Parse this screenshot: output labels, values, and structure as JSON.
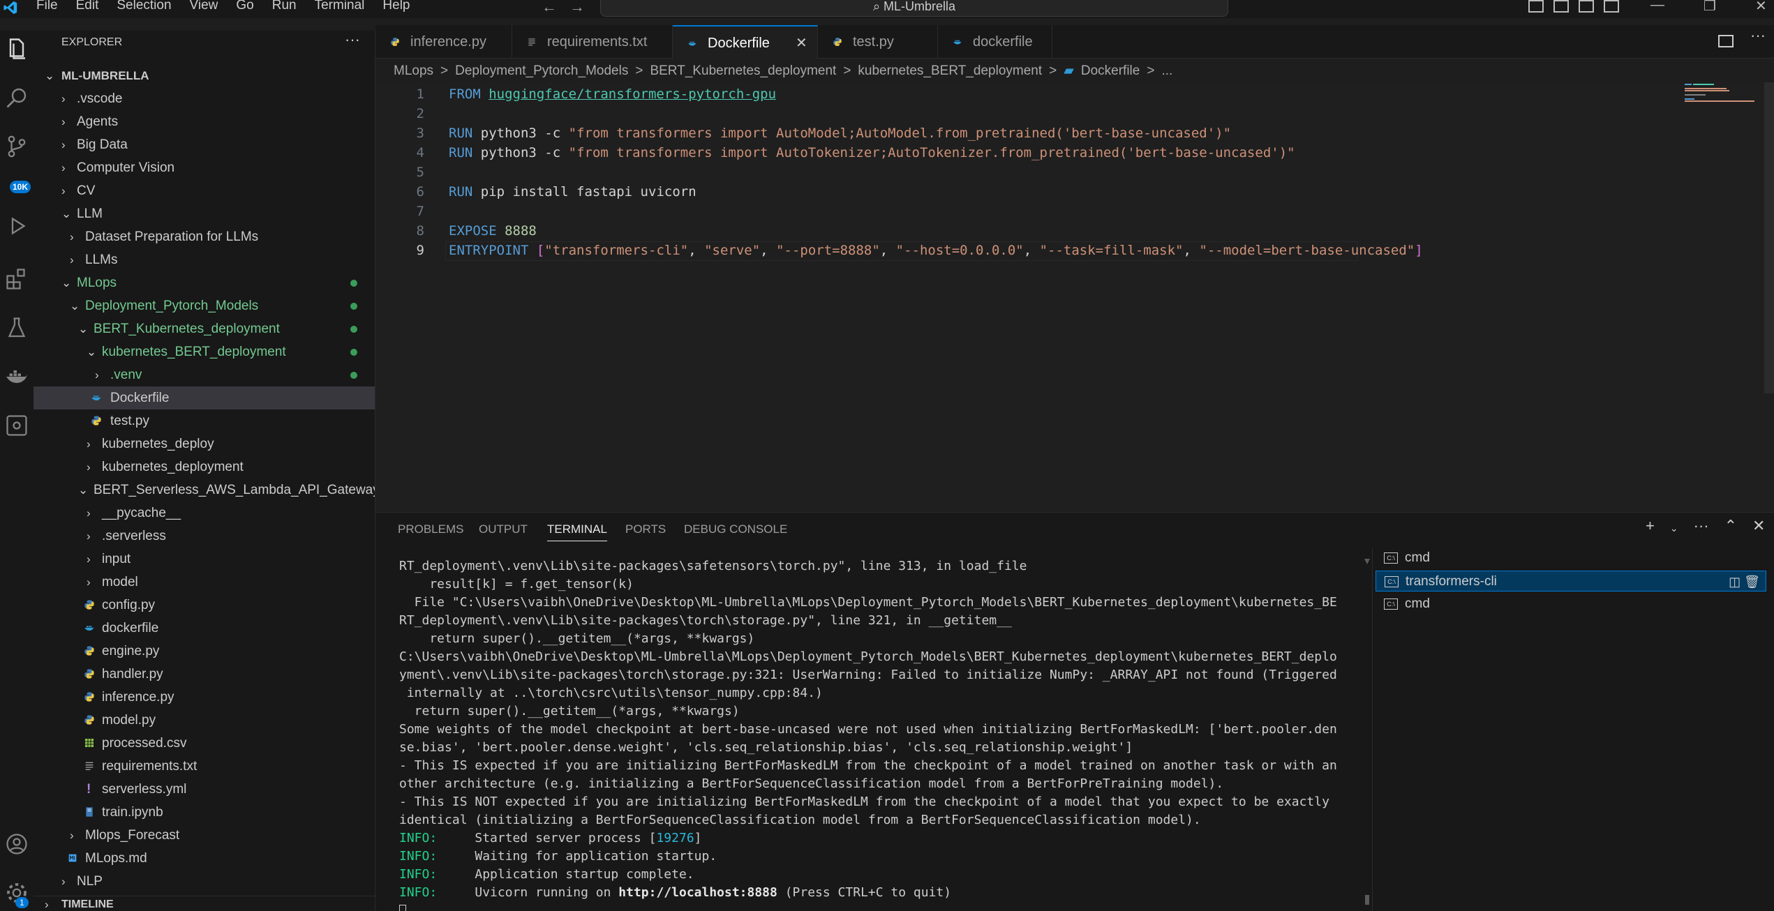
{
  "menu": [
    "File",
    "Edit",
    "Selection",
    "View",
    "Go",
    "Run",
    "Terminal",
    "Help"
  ],
  "search": {
    "text": "ML-Umbrella"
  },
  "activity": {
    "scm_badge": "10K",
    "accounts_badge": "1"
  },
  "explorer": {
    "title": "EXPLORER",
    "root": "ML-UMBRELLA",
    "items": [
      {
        "label": ".vscode",
        "type": "folder",
        "open": false
      },
      {
        "label": "Agents",
        "type": "folder",
        "open": false
      },
      {
        "label": "Big Data",
        "type": "folder",
        "open": false
      },
      {
        "label": "Computer Vision",
        "type": "folder",
        "open": false
      },
      {
        "label": "CV",
        "type": "folder",
        "open": false
      },
      {
        "label": "LLM",
        "type": "folder",
        "open": true
      },
      {
        "label": "Dataset Preparation for LLMs",
        "type": "folder",
        "open": false
      },
      {
        "label": "LLMs",
        "type": "folder",
        "open": false
      },
      {
        "label": "MLops",
        "type": "folder",
        "open": true
      },
      {
        "label": "Deployment_Pytorch_Models",
        "type": "folder",
        "open": true
      },
      {
        "label": "BERT_Kubernetes_deployment",
        "type": "folder",
        "open": true
      },
      {
        "label": "kubernetes_BERT_deployment",
        "type": "folder",
        "open": true
      },
      {
        "label": ".venv",
        "type": "folder",
        "open": false
      },
      {
        "label": "Dockerfile",
        "type": "docker"
      },
      {
        "label": "test.py",
        "type": "python"
      },
      {
        "label": "kubernetes_deploy",
        "type": "folder",
        "open": false
      },
      {
        "label": "kubernetes_deployment",
        "type": "folder",
        "open": false
      },
      {
        "label": "BERT_Serverless_AWS_Lambda_API_Gateway",
        "type": "folder",
        "open": true
      },
      {
        "label": "__pycache__",
        "type": "folder",
        "open": false
      },
      {
        "label": ".serverless",
        "type": "folder",
        "open": false
      },
      {
        "label": "input",
        "type": "folder",
        "open": false
      },
      {
        "label": "model",
        "type": "folder",
        "open": false
      },
      {
        "label": "config.py",
        "type": "python"
      },
      {
        "label": "dockerfile",
        "type": "docker"
      },
      {
        "label": "engine.py",
        "type": "python"
      },
      {
        "label": "handler.py",
        "type": "python"
      },
      {
        "label": "inference.py",
        "type": "python"
      },
      {
        "label": "model.py",
        "type": "python"
      },
      {
        "label": "processed.csv",
        "type": "csv"
      },
      {
        "label": "requirements.txt",
        "type": "text"
      },
      {
        "label": "serverless.yml",
        "type": "yaml"
      },
      {
        "label": "train.ipynb",
        "type": "notebook"
      },
      {
        "label": "Mlops_Forecast",
        "type": "folder",
        "open": false
      },
      {
        "label": "MLops.md",
        "type": "markdown"
      },
      {
        "label": "NLP",
        "type": "folder",
        "open": false
      }
    ],
    "timeline": "TIMELINE"
  },
  "tabs": [
    {
      "label": "inference.py"
    },
    {
      "label": "requirements.txt"
    },
    {
      "label": "Dockerfile",
      "active": true
    },
    {
      "label": "test.py"
    },
    {
      "label": "dockerfile"
    }
  ],
  "breadcrumb": [
    "MLops",
    ">",
    "Deployment_Pytorch_Models",
    ">",
    "BERT_Kubernetes_deployment",
    ">",
    "kubernetes_BERT_deployment",
    ">",
    "Dockerfile",
    ">",
    "..."
  ],
  "editor": {
    "line_numbers": [
      "1",
      "2",
      "3",
      "4",
      "5",
      "6",
      "7",
      "8",
      "9"
    ],
    "l1_kw": "FROM",
    "l1_img": "huggingface/transformers-pytorch-gpu",
    "l3_kw": "RUN",
    "l3_cmd": "python3 -c",
    "l3_str": "\"from transformers import AutoModel;AutoModel.from_pretrained('bert-base-uncased')\"",
    "l4_kw": "RUN",
    "l4_cmd": "python3 -c",
    "l4_str": "\"from transformers import AutoTokenizer;AutoTokenizer.from_pretrained('bert-base-uncased')\"",
    "l6_kw": "RUN",
    "l6_cmd": "pip install fastapi uvicorn",
    "l8_kw": "EXPOSE",
    "l8_num": "8888",
    "l9_kw": "ENTRYPOINT",
    "l9_open": "[",
    "l9_args": [
      "\"transformers-cli\"",
      "\"serve\"",
      "\"--port=8888\"",
      "\"--host=0.0.0.0\"",
      "\"--task=fill-mask\"",
      "\"--model=bert-base-uncased\""
    ],
    "l9_close": "]"
  },
  "panel": {
    "tabs": [
      "PROBLEMS",
      "OUTPUT",
      "TERMINAL",
      "PORTS",
      "DEBUG CONSOLE"
    ],
    "active_tab": "TERMINAL",
    "terminal_lines": [
      "RT_deployment\\.venv\\Lib\\site-packages\\safetensors\\torch.py\", line 313, in load_file",
      "    result[k] = f.get_tensor(k)",
      "  File \"C:\\Users\\vaibh\\OneDrive\\Desktop\\ML-Umbrella\\MLops\\Deployment_Pytorch_Models\\BERT_Kubernetes_deployment\\kubernetes_BE",
      "RT_deployment\\.venv\\Lib\\site-packages\\torch\\storage.py\", line 321, in __getitem__",
      "    return super().__getitem__(*args, **kwargs)",
      "C:\\Users\\vaibh\\OneDrive\\Desktop\\ML-Umbrella\\MLops\\Deployment_Pytorch_Models\\BERT_Kubernetes_deployment\\kubernetes_BERT_deplo",
      "yment\\.venv\\Lib\\site-packages\\torch\\storage.py:321: UserWarning: Failed to initialize NumPy: _ARRAY_API not found (Triggered",
      " internally at ..\\torch\\csrc\\utils\\tensor_numpy.cpp:84.)",
      "  return super().__getitem__(*args, **kwargs)",
      "Some weights of the model checkpoint at bert-base-uncased were not used when initializing BertForMaskedLM: ['bert.pooler.den",
      "se.bias', 'bert.pooler.dense.weight', 'cls.seq_relationship.bias', 'cls.seq_relationship.weight']",
      "- This IS expected if you are initializing BertForMaskedLM from the checkpoint of a model trained on another task or with an",
      "other architecture (e.g. initializing a BertForSequenceClassification model from a BertForPreTraining model).",
      "- This IS NOT expected if you are initializing BertForMaskedLM from the checkpoint of a model that you expect to be exactly",
      "identical (initializing a BertForSequenceClassification model from a BertForSequenceClassification model)."
    ],
    "info_label": "INFO:",
    "info1_pre": "     Started server process [",
    "info1_pid": "19276",
    "info1_post": "]",
    "info2": "     Waiting for application startup.",
    "info3": "     Application startup complete.",
    "info4_pre": "     Uvicorn running on ",
    "info4_url": "http://localhost:8888",
    "info4_post": " (Press CTRL+C to quit)",
    "terminals": [
      {
        "label": "cmd"
      },
      {
        "label": "transformers-cli",
        "selected": true
      },
      {
        "label": "cmd"
      }
    ]
  },
  "colors": {
    "accent": "#0078d4",
    "keyword": "#569cd6",
    "string": "#ce9178",
    "info": "#23d18b",
    "git_added": "#73c991"
  }
}
